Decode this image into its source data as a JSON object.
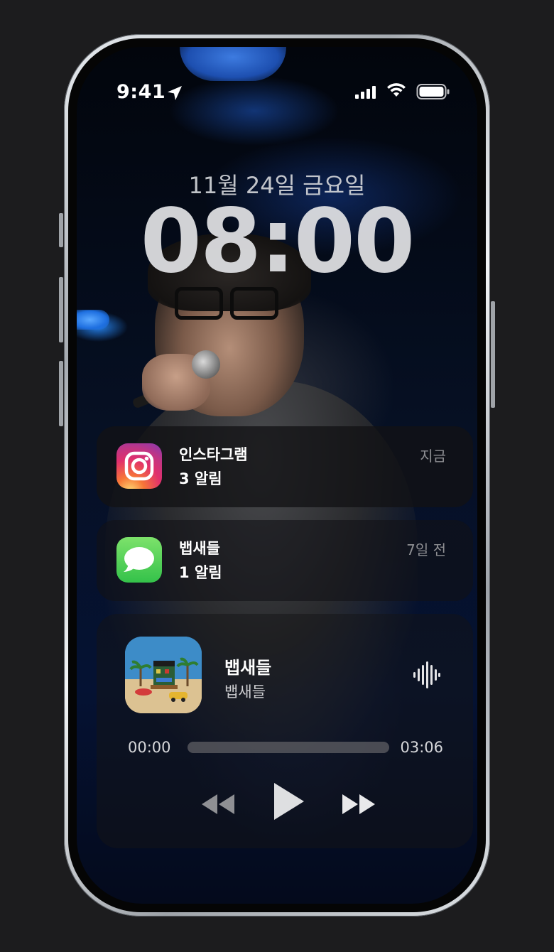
{
  "status_bar": {
    "time": "9:41",
    "icons": [
      "location-arrow-icon",
      "cellular-signal-icon",
      "wifi-icon",
      "battery-icon"
    ]
  },
  "lock_screen": {
    "date": "11월 24일 금요일",
    "time": "08:00"
  },
  "notifications": [
    {
      "app_name": "인스타그램",
      "message": "3 알림",
      "time": "지금",
      "icon": "instagram-icon"
    },
    {
      "app_name": "뱁새들",
      "message": "1 알림",
      "time": "7일 전",
      "icon": "messages-icon"
    }
  ],
  "now_playing": {
    "title": "뱁새들",
    "artist": "뱁새들",
    "elapsed": "00:00",
    "duration": "03:06",
    "progress": 0,
    "controls": [
      "rewind-icon",
      "play-icon",
      "fast-forward-icon"
    ]
  },
  "colors": {
    "background": "#1c1c1e",
    "notification_time": "#8e8f93",
    "progress_track": "#5f5f64"
  }
}
